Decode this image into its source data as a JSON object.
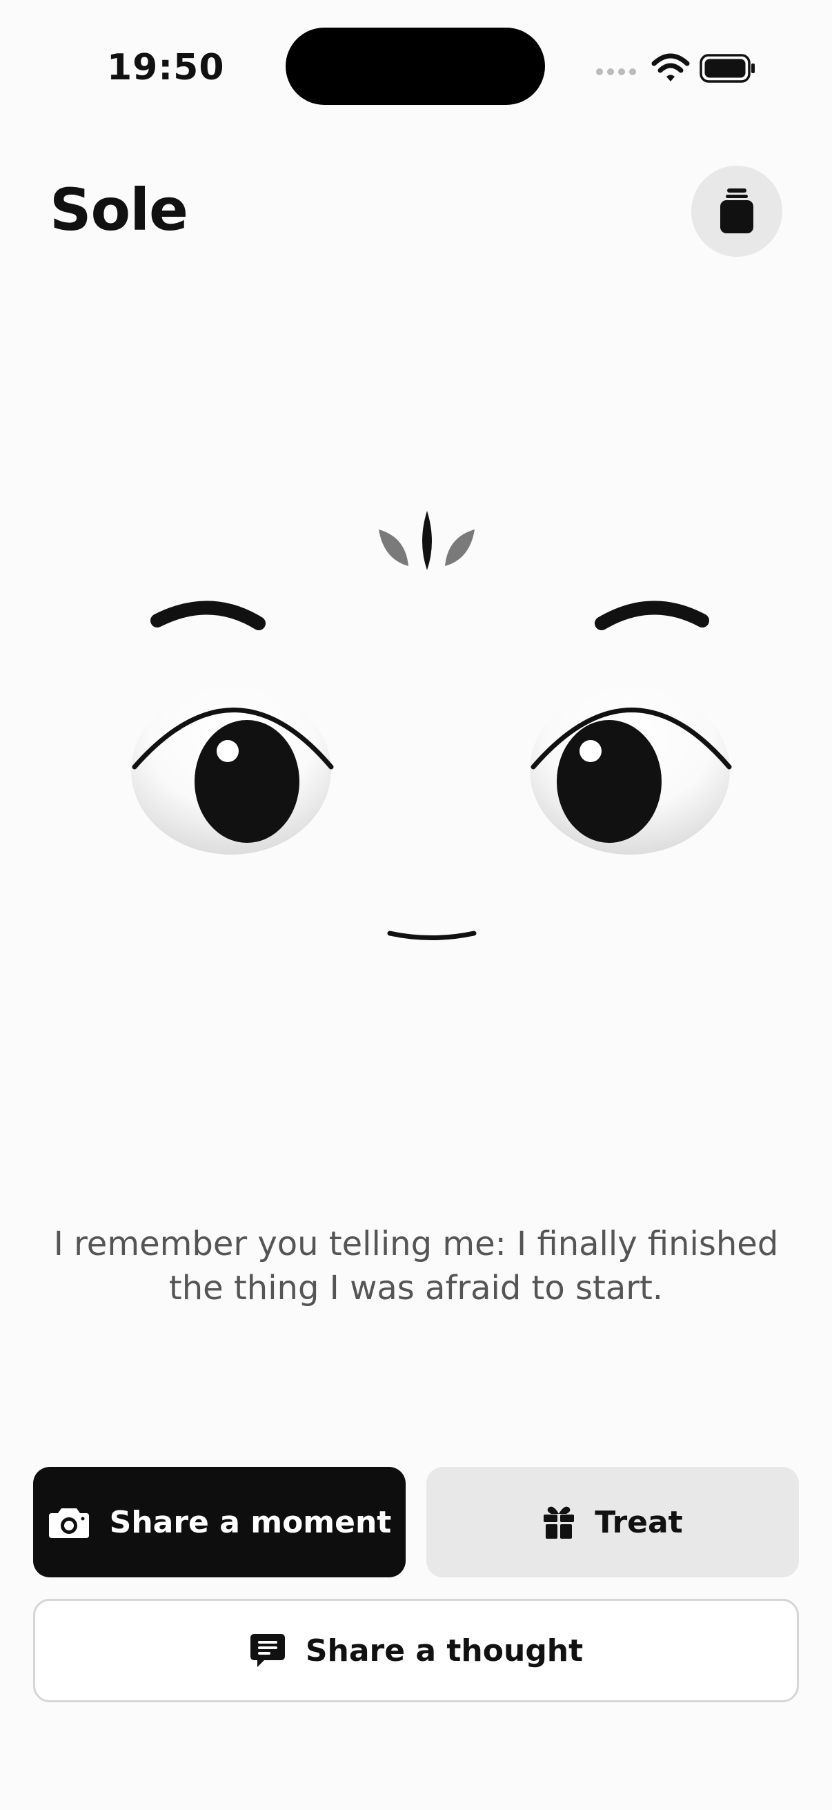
{
  "status_bar": {
    "time": "19:50"
  },
  "header": {
    "title": "Sole",
    "jar_icon": "jar-icon"
  },
  "mascot": {
    "name": "face-illustration",
    "colors": {
      "ink": "#111111",
      "sprout_side": "#7a7a7a"
    }
  },
  "memory": {
    "text": "I remember you telling me: I finally finished the thing I was afraid to start."
  },
  "actions": {
    "share_moment": {
      "label": "Share a moment",
      "icon": "camera-icon"
    },
    "treat": {
      "label": "Treat",
      "icon": "gift-icon"
    },
    "share_thought": {
      "label": "Share a thought",
      "icon": "message-icon"
    }
  },
  "colors": {
    "background": "#fbfbfb",
    "primary_button": "#0e0e0e",
    "secondary_button": "#e8e8e8"
  }
}
